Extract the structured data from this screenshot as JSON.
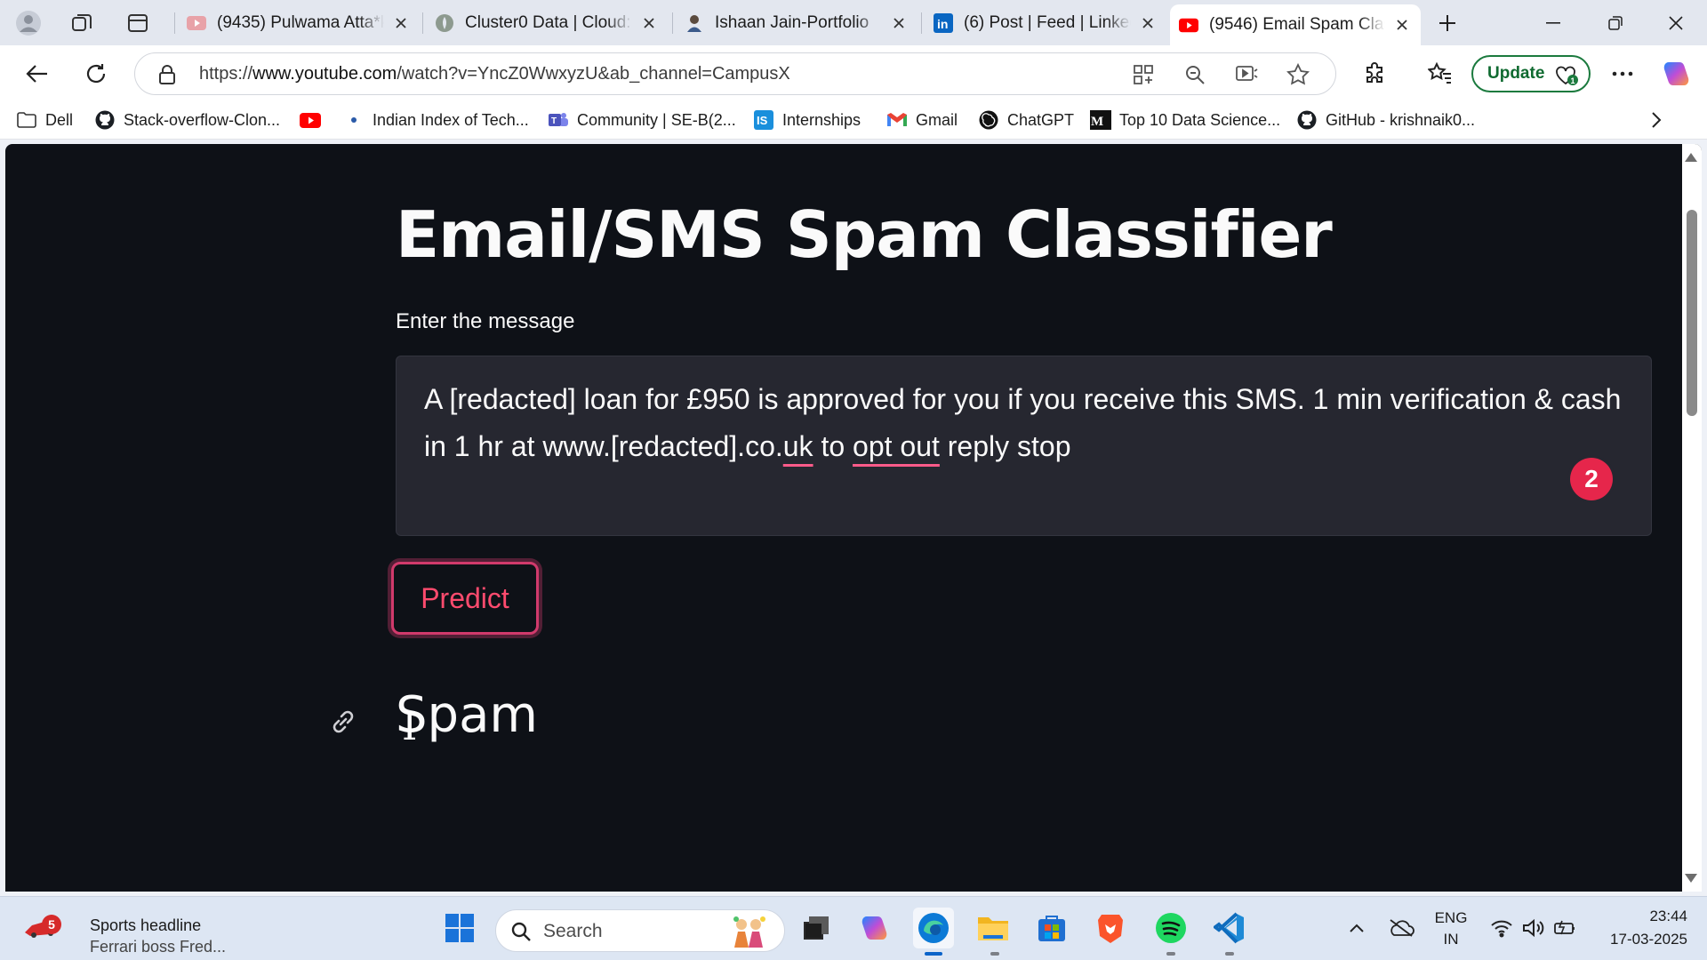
{
  "browser": {
    "tabs": [
      {
        "title": "(9435) Pulwama Atta*k I",
        "favicon": "youtube-icon",
        "active": false
      },
      {
        "title": "Cluster0 Data | Cloud: M",
        "favicon": "mongodb-leaf-icon",
        "active": false
      },
      {
        "title": "Ishaan Jain-Portfolio",
        "favicon": "portfolio-avatar-icon",
        "active": false
      },
      {
        "title": "(6) Post | Feed | LinkedIn",
        "favicon": "linkedin-icon",
        "active": false
      },
      {
        "title": "(9546) Email Spam Clas",
        "favicon": "youtube-icon",
        "active": true
      }
    ],
    "url_prefix": "https://",
    "url_domain": "www.youtube.com",
    "url_path": "/watch?v=YncZ0WwxyzU&ab_channel=CampusX",
    "update_label": "Update",
    "bookmarks": [
      {
        "label": "Dell",
        "icon": "folder-icon"
      },
      {
        "label": "Stack-overflow-Clon...",
        "icon": "github-icon"
      },
      {
        "label": "",
        "icon": "youtube-icon"
      },
      {
        "label": "Indian Index of Tech...",
        "icon": "site-dot-icon"
      },
      {
        "label": "Community | SE-B(2...",
        "icon": "teams-icon"
      },
      {
        "label": "Internships",
        "icon": "internshala-icon"
      },
      {
        "label": "Gmail",
        "icon": "gmail-icon"
      },
      {
        "label": "ChatGPT",
        "icon": "chatgpt-icon"
      },
      {
        "label": "Top 10 Data Science...",
        "icon": "medium-icon"
      },
      {
        "label": "GitHub - krishnaik0...",
        "icon": "github-icon"
      }
    ]
  },
  "app": {
    "title": "Email/SMS Spam Classifier",
    "input_label": "Enter the message",
    "message_part1": "A [redacted] loan for £950 is approved for you if you receive this SMS. 1 min verification & cash in 1 hr at www.[redacted].co.",
    "message_ul1": "uk",
    "message_part2": " to ",
    "message_ul2": "opt out",
    "message_part3": " reply stop",
    "grammar_badge": "2",
    "predict_label": "Predict",
    "result": "Spam",
    "accent_color": "#ff4b6e",
    "background_color": "#0e1117"
  },
  "taskbar": {
    "news_badge": "5",
    "news_title": "Sports headline",
    "news_subtitle": "Ferrari boss Fred...",
    "search_placeholder": "Search",
    "lang_line1": "ENG",
    "lang_line2": "IN",
    "time": "23:44",
    "date": "17-03-2025"
  }
}
